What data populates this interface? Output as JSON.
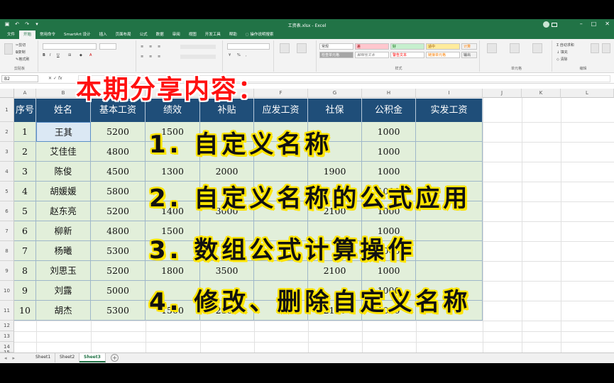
{
  "window": {
    "title": "工资表.xlsx - Excel"
  },
  "ribbon_tabs": [
    "文件",
    "开始",
    "常用命令",
    "SmartArt 设计",
    "插入",
    "页面布局",
    "公式",
    "数据",
    "审阅",
    "视图",
    "开发工具",
    "帮助",
    "操作说明搜索"
  ],
  "ribbon": {
    "clipboard": {
      "cut": "剪切",
      "copy": "复制",
      "format_painter": "格式刷",
      "label": "剪贴板"
    },
    "styles": {
      "cells": [
        "常规",
        "差",
        "好",
        "适中",
        "计算",
        "检查单元格",
        "解释性文本",
        "警告文本",
        "链接单元格",
        "输出"
      ],
      "label": "样式"
    },
    "cells_label": "单元格",
    "editing": {
      "autosum": "自动求和",
      "fill": "填充",
      "clear": "清除",
      "label": "编辑"
    }
  },
  "formula_bar": {
    "name_box": "B2",
    "fx": "fx"
  },
  "columns": [
    "A",
    "B",
    "C",
    "D",
    "E",
    "F",
    "G",
    "H",
    "I",
    "J",
    "K",
    "L"
  ],
  "rows": [
    "1",
    "2",
    "3",
    "4",
    "5",
    "6",
    "7",
    "8",
    "9",
    "10",
    "11",
    "12",
    "13",
    "14",
    "15"
  ],
  "table": {
    "headers": [
      "序号",
      "姓名",
      "基本工资",
      "绩效",
      "补贴",
      "应发工资",
      "社保",
      "公积金",
      "实发工资"
    ],
    "rows": [
      [
        "1",
        "王其",
        "5200",
        "1500",
        "",
        "",
        "",
        "1000",
        ""
      ],
      [
        "2",
        "艾佳佳",
        "4800",
        "",
        "",
        "",
        "",
        "1000",
        ""
      ],
      [
        "3",
        "陈俊",
        "4500",
        "1300",
        "2000",
        "",
        "1900",
        "1000",
        ""
      ],
      [
        "4",
        "胡媛媛",
        "5800",
        "",
        "",
        "",
        "",
        "1000",
        ""
      ],
      [
        "5",
        "赵东亮",
        "5200",
        "1400",
        "3000",
        "",
        "2100",
        "1000",
        ""
      ],
      [
        "6",
        "柳新",
        "4800",
        "1500",
        "",
        "",
        "",
        "1000",
        ""
      ],
      [
        "7",
        "杨曦",
        "5300",
        "",
        "",
        "",
        "",
        "1000",
        ""
      ],
      [
        "8",
        "刘思玉",
        "5200",
        "1800",
        "3500",
        "",
        "2100",
        "1000",
        ""
      ],
      [
        "9",
        "刘露",
        "5000",
        "",
        "",
        "",
        "",
        "1000",
        ""
      ],
      [
        "10",
        "胡杰",
        "5300",
        "1500",
        "2800",
        "",
        "2100",
        "1000",
        ""
      ]
    ]
  },
  "overlay": {
    "title": "本期分享内容：",
    "items": [
      "1. 自定义名称",
      "2. 自定义名称的公式应用",
      "3. 数组公式计算操作",
      "4. 修改、删除自定义名称"
    ]
  },
  "sheets": {
    "tabs": [
      "Sheet1",
      "Sheet2",
      "Sheet3"
    ],
    "active": "Sheet3"
  },
  "colors": {
    "excel_green": "#217346",
    "header_fill": "#1f4e79",
    "body_fill": "#e2efda",
    "overlay_title": "#ff1010",
    "overlay_items_outline": "#ffe400"
  }
}
